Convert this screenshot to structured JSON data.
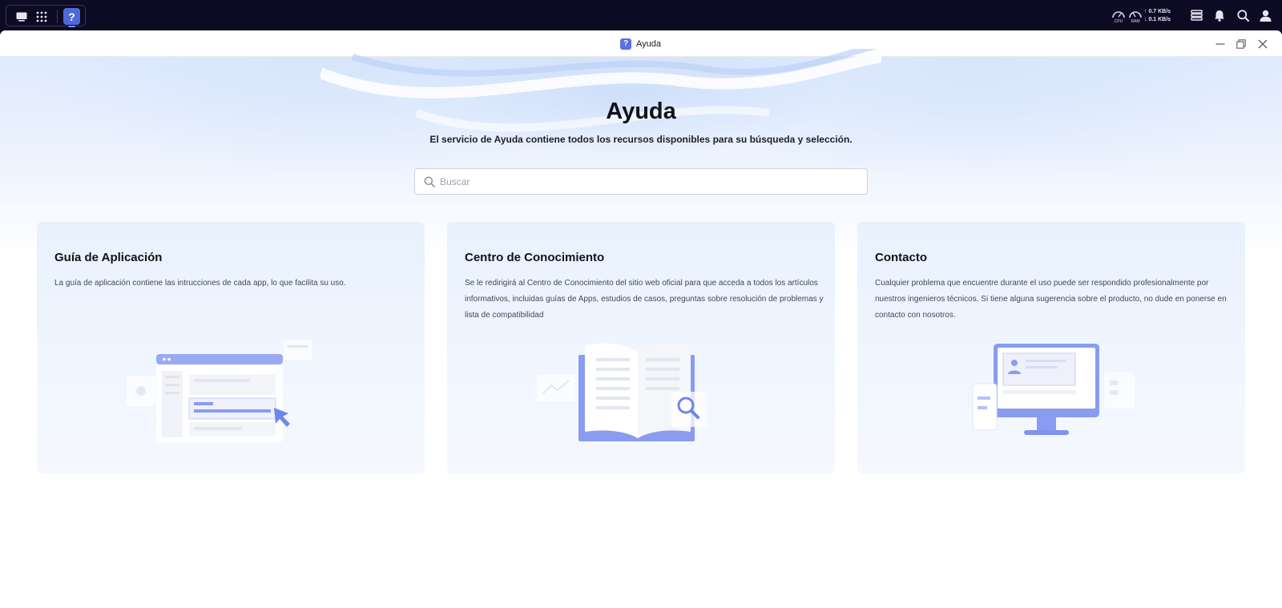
{
  "taskbar": {
    "icons": [
      "desktop-icon",
      "app-grid-icon",
      "help-app-icon"
    ],
    "active_app_glyph": "?",
    "cpu_label": "CPU",
    "ram_label": "RAM",
    "net_up": "0.7 KB/s",
    "net_down": "0.1 KB/s",
    "tray_icons": [
      "task-manager-icon",
      "bell-icon",
      "search-icon",
      "user-icon"
    ]
  },
  "window": {
    "title": "Ayuda",
    "app_glyph": "?",
    "controls": [
      "minimize-icon",
      "restore-icon",
      "close-icon"
    ]
  },
  "hero": {
    "title": "Ayuda",
    "subtitle": "El servicio de Ayuda contiene todos los recursos disponibles para su búsqueda y selección.",
    "search_placeholder": "Buscar"
  },
  "cards": [
    {
      "title": "Guía de Aplicación",
      "description": "La guía de aplicación contiene las intrucciones de cada app, lo que facilita su uso.",
      "illustration": "app-window-illustration"
    },
    {
      "title": "Centro de Conocimiento",
      "description": "Se le redirigirá al Centro de Conocimiento del sitio web oficial para que acceda a todos los artículos informativos, incluidas guías de Apps, estudios de casos, preguntas sobre resolución de problemas y lista de compatibilidad",
      "illustration": "open-book-illustration"
    },
    {
      "title": "Contacto",
      "description": "Cualquier problema que encuentre durante el uso puede ser respondido profesionalmente por nuestros ingenieros técnicos. Si tiene alguna sugerencia sobre el producto, no dude en ponerse en contacto con nosotros.",
      "illustration": "monitor-phone-illustration"
    }
  ],
  "colors": {
    "taskbar_bg": "#0d0a24",
    "accent": "#5b6fe0",
    "card_bg": "#e8f1fd",
    "illustration": "#8a9cf0"
  }
}
